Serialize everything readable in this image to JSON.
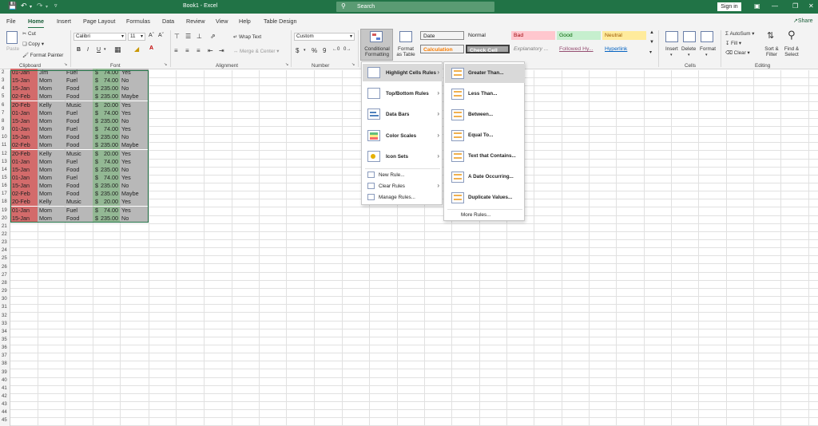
{
  "titlebar": {
    "title": "Book1 - Excel",
    "search_placeholder": "Search",
    "signin": "Sign in",
    "undo_icon": "undo-icon",
    "redo_icon": "redo-icon"
  },
  "menubar": {
    "tabs": [
      "File",
      "Home",
      "Insert",
      "Page Layout",
      "Formulas",
      "Data",
      "Review",
      "View",
      "Help",
      "Table Design"
    ],
    "active": "Home",
    "share": "Share"
  },
  "ribbon": {
    "clipboard": {
      "paste": "Paste",
      "cut": "Cut",
      "copy": "Copy",
      "format_painter": "Format Painter",
      "label": "Clipboard"
    },
    "font": {
      "name": "Calibri",
      "size": "11",
      "bold": "B",
      "italic": "I",
      "underline": "U",
      "label": "Font"
    },
    "alignment": {
      "wrap_text": "Wrap Text",
      "merge_center": "Merge & Center",
      "label": "Alignment"
    },
    "number": {
      "format": "Custom",
      "currency": "$",
      "percent": "%",
      "comma": "9",
      "label": "Number"
    },
    "styles": {
      "conditional_formatting": "Conditional Formatting",
      "format_as_table": "Format as Table",
      "cells": [
        {
          "label": "Date",
          "bg": "#ffffff",
          "color": "#222222"
        },
        {
          "label": "Normal",
          "bg": "#ffffff",
          "color": "#222222"
        },
        {
          "label": "Bad",
          "bg": "#ffc7ce",
          "color": "#9c0006"
        },
        {
          "label": "Good",
          "bg": "#c6efce",
          "color": "#006100"
        },
        {
          "label": "Neutral",
          "bg": "#ffeb9c",
          "color": "#9c5700"
        },
        {
          "label": "Calculation",
          "bg": "#f2f2f2",
          "color": "#fa7d00"
        },
        {
          "label": "Check Cell",
          "bg": "#a5a5a5",
          "color": "#ffffff"
        },
        {
          "label": "Explanatory ...",
          "bg": "#ffffff",
          "color": "#7f7f7f"
        },
        {
          "label": "Followed Hy...",
          "bg": "#ffffff",
          "color": "#954f72"
        },
        {
          "label": "Hyperlink",
          "bg": "#ffffff",
          "color": "#0563c1"
        }
      ]
    },
    "cells": {
      "insert": "Insert",
      "delete": "Delete",
      "format": "Format",
      "label": "Cells"
    },
    "editing": {
      "autosum": "AutoSum",
      "fill": "Fill",
      "clear": "Clear",
      "sort_filter": "Sort & Filter",
      "find_select": "Find & Select",
      "label": "Editing"
    }
  },
  "grid": {
    "row_numbers": [
      "2",
      "3",
      "4",
      "5",
      "6",
      "7",
      "8",
      "9",
      "10",
      "11",
      "12",
      "13",
      "14",
      "15",
      "16",
      "17",
      "18",
      "19",
      "20",
      "21",
      "22",
      "23",
      "24",
      "25",
      "26",
      "27",
      "28",
      "29",
      "30",
      "31",
      "32",
      "33",
      "34",
      "35",
      "36",
      "37",
      "38",
      "39",
      "40",
      "41",
      "42",
      "43",
      "44",
      "45",
      "46"
    ],
    "rows": [
      {
        "date": "01-Jan",
        "who": "Jim",
        "cat": "Fuel",
        "cur": "$",
        "amt": "74.00",
        "flag": "Yes"
      },
      {
        "date": "15-Jan",
        "who": "Mom",
        "cat": "Fuel",
        "cur": "$",
        "amt": "74.00",
        "flag": "No"
      },
      {
        "date": "15-Jan",
        "who": "Mom",
        "cat": "Food",
        "cur": "$",
        "amt": "235.00",
        "flag": "No"
      },
      {
        "date": "02-Feb",
        "who": "Mom",
        "cat": "Food",
        "cur": "$",
        "amt": "235.00",
        "flag": "Maybe"
      },
      {
        "date": "20-Feb",
        "who": "Kelly",
        "cat": "Music",
        "cur": "$",
        "amt": "20.00",
        "flag": "Yes"
      },
      {
        "date": "01-Jan",
        "who": "Mom",
        "cat": "Fuel",
        "cur": "$",
        "amt": "74.00",
        "flag": "Yes"
      },
      {
        "date": "15-Jan",
        "who": "Mom",
        "cat": "Food",
        "cur": "$",
        "amt": "235.00",
        "flag": "No"
      },
      {
        "date": "01-Jan",
        "who": "Mom",
        "cat": "Fuel",
        "cur": "$",
        "amt": "74.00",
        "flag": "Yes"
      },
      {
        "date": "15-Jan",
        "who": "Mom",
        "cat": "Food",
        "cur": "$",
        "amt": "235.00",
        "flag": "No"
      },
      {
        "date": "02-Feb",
        "who": "Mom",
        "cat": "Food",
        "cur": "$",
        "amt": "235.00",
        "flag": "Maybe"
      },
      {
        "date": "20-Feb",
        "who": "Kelly",
        "cat": "Music",
        "cur": "$",
        "amt": "20.00",
        "flag": "Yes"
      },
      {
        "date": "01-Jan",
        "who": "Mom",
        "cat": "Fuel",
        "cur": "$",
        "amt": "74.00",
        "flag": "Yes"
      },
      {
        "date": "15-Jan",
        "who": "Mom",
        "cat": "Food",
        "cur": "$",
        "amt": "235.00",
        "flag": "No"
      },
      {
        "date": "01-Jan",
        "who": "Mom",
        "cat": "Fuel",
        "cur": "$",
        "amt": "74.00",
        "flag": "Yes"
      },
      {
        "date": "15-Jan",
        "who": "Mom",
        "cat": "Food",
        "cur": "$",
        "amt": "235.00",
        "flag": "No"
      },
      {
        "date": "02-Feb",
        "who": "Mom",
        "cat": "Food",
        "cur": "$",
        "amt": "235.00",
        "flag": "Maybe"
      },
      {
        "date": "20-Feb",
        "who": "Kelly",
        "cat": "Music",
        "cur": "$",
        "amt": "20.00",
        "flag": "Yes"
      },
      {
        "date": "01-Jan",
        "who": "Mom",
        "cat": "Fuel",
        "cur": "$",
        "amt": "74.00",
        "flag": "Yes"
      },
      {
        "date": "15-Jan",
        "who": "Mom",
        "cat": "Food",
        "cur": "$",
        "amt": "235.00",
        "flag": "No"
      }
    ]
  },
  "cf_menu": {
    "items": [
      "Highlight Cells Rules",
      "Top/Bottom Rules",
      "Data Bars",
      "Color Scales",
      "Icon Sets"
    ],
    "small_items": [
      "New Rule...",
      "Clear Rules",
      "Manage Rules..."
    ]
  },
  "submenu": {
    "items": [
      "Greater Than...",
      "Less Than...",
      "Between...",
      "Equal To...",
      "Text that Contains...",
      "A Date Occurring...",
      "Duplicate Values..."
    ],
    "more": "More Rules..."
  }
}
